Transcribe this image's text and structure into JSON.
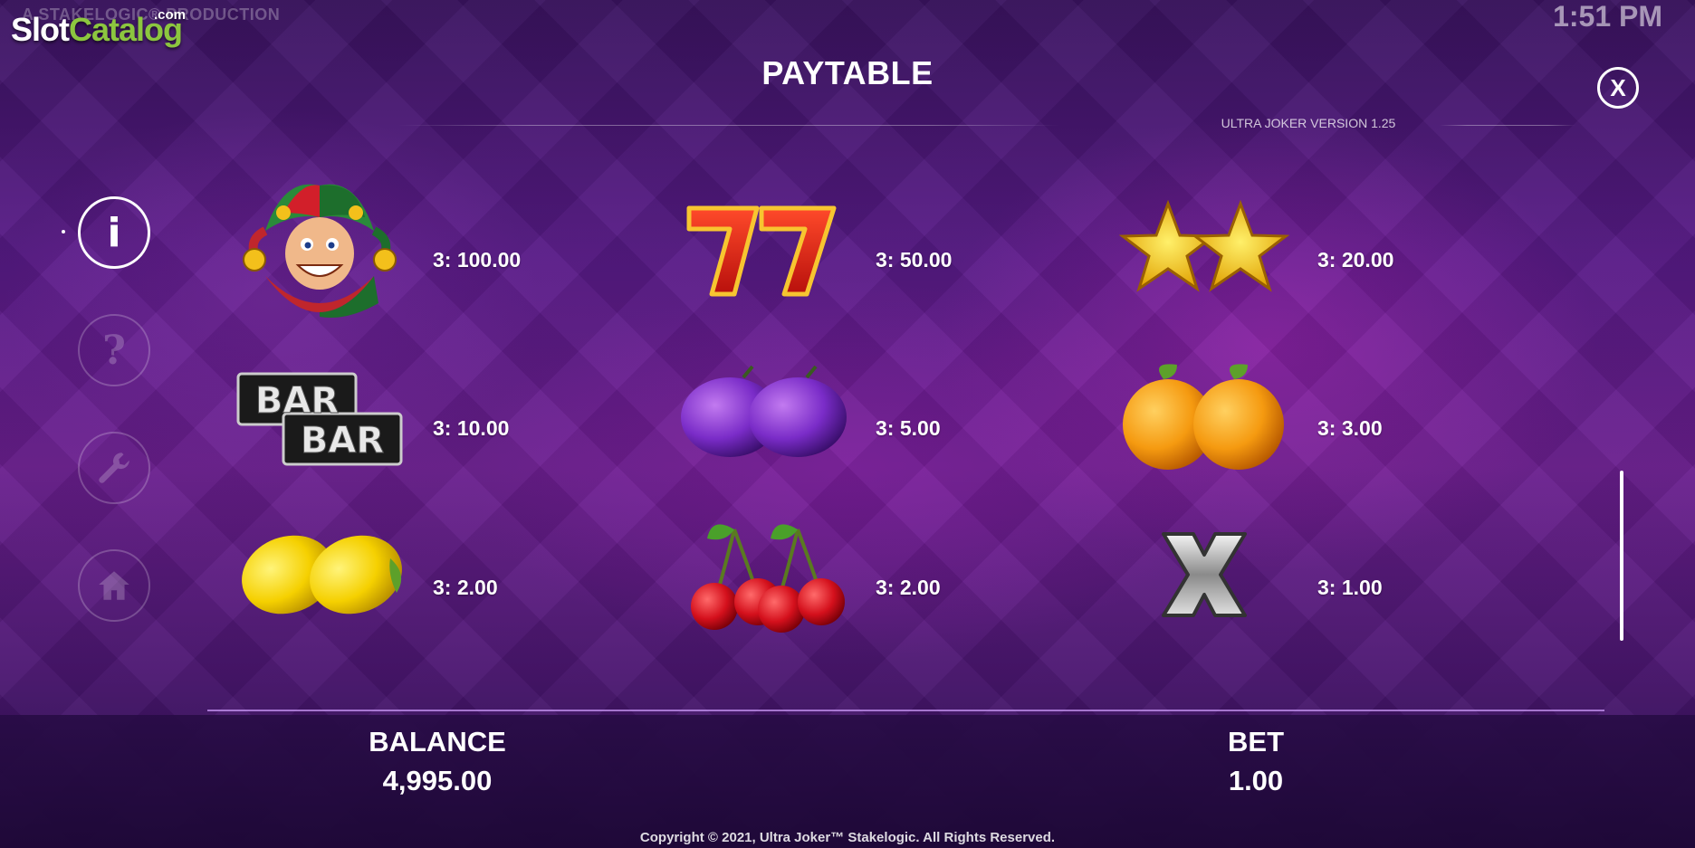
{
  "branding": {
    "studio_line": "A STAKELOGIC® PRODUCTION",
    "logo_slot": "Slot",
    "logo_catalog": "Catalog",
    "logo_com": ".com"
  },
  "clock": "1:51 PM",
  "header": {
    "title": "PAYTABLE",
    "version": "ULTRA JOKER VERSION 1.25",
    "close_label": "X"
  },
  "sidebar": {
    "items": [
      {
        "name": "info",
        "glyph": "i",
        "active": true
      },
      {
        "name": "help",
        "glyph": "?",
        "active": false
      },
      {
        "name": "settings",
        "glyph": "wrench",
        "active": false
      },
      {
        "name": "home",
        "glyph": "house",
        "active": false
      }
    ]
  },
  "paytable": [
    {
      "symbol": "joker",
      "payout": "3: 100.00"
    },
    {
      "symbol": "double-seven",
      "payout": "3: 50.00"
    },
    {
      "symbol": "double-star",
      "payout": "3: 20.00"
    },
    {
      "symbol": "bar-bar",
      "payout": "3: 10.00",
      "symbol_text": [
        "BAR",
        "BAR"
      ]
    },
    {
      "symbol": "plums",
      "payout": "3: 5.00"
    },
    {
      "symbol": "oranges",
      "payout": "3: 3.00"
    },
    {
      "symbol": "lemons",
      "payout": "3: 2.00"
    },
    {
      "symbol": "cherries",
      "payout": "3: 2.00"
    },
    {
      "symbol": "silver-x",
      "payout": "3: 1.00"
    }
  ],
  "footer": {
    "balance_label": "BALANCE",
    "balance_value": "4,995.00",
    "bet_label": "BET",
    "bet_value": "1.00",
    "copyright": "Copyright © 2021, Ultra Joker™ Stakelogic. All Rights Reserved."
  },
  "colors": {
    "logo_green": "#8cc63f",
    "background_purple": "#571a86",
    "footer_bg": "#280c46"
  }
}
